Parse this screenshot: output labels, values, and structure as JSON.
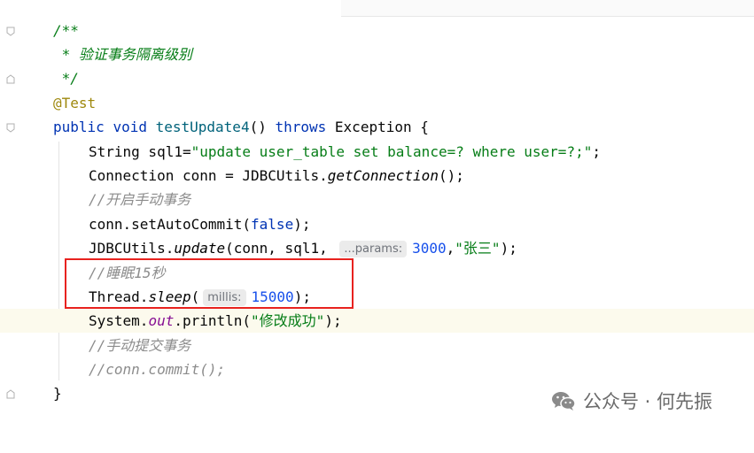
{
  "code": {
    "doc_open": "/**",
    "doc_line": " * 验证事务隔离级别",
    "doc_close": " */",
    "annotation": "@Test",
    "sig_public": "public",
    "sig_void": "void",
    "sig_name": "testUpdate4",
    "sig_parens": "() ",
    "sig_throws": "throws",
    "sig_exception": " Exception {",
    "l1_type": "String sql1=",
    "l1_str": "\"update user_table set balance=? where user=?;\"",
    "l1_end": ";",
    "l2_a": "Connection conn = JDBCUtils.",
    "l2_fn": "getConnection",
    "l2_b": "();",
    "c1": "//开启手动事务",
    "l3_a": "conn.setAutoCommit(",
    "l3_kw": "false",
    "l3_b": ");",
    "l4_a": "JDBCUtils.",
    "l4_fn": "update",
    "l4_b": "(conn, sql1, ",
    "l4_hint": "...params:",
    "l4_num": "3000",
    "l4_c": ",",
    "l4_str": "\"张三\"",
    "l4_d": ");",
    "c2": "//睡眠15秒",
    "l5_a": "Thread.",
    "l5_fn": "sleep",
    "l5_b": "(",
    "l5_hint": "millis:",
    "l5_num": "15000",
    "l5_c": ");",
    "l6_a": "System.",
    "l6_field": "out",
    "l6_b": ".println(",
    "l6_str": "\"修改成功\"",
    "l6_c": ");",
    "c3": "//手动提交事务",
    "c4": "//conn.commit();",
    "close_brace": "}"
  },
  "watermark": {
    "text": "公众号 · 何先振",
    "icon": "wechat-icon"
  },
  "colors": {
    "keyword": "#0033b3",
    "comment": "#8c8c8c",
    "string": "#067d17",
    "number": "#1750eb",
    "annotation": "#9e880d",
    "highlight_box": "#e8221f"
  }
}
